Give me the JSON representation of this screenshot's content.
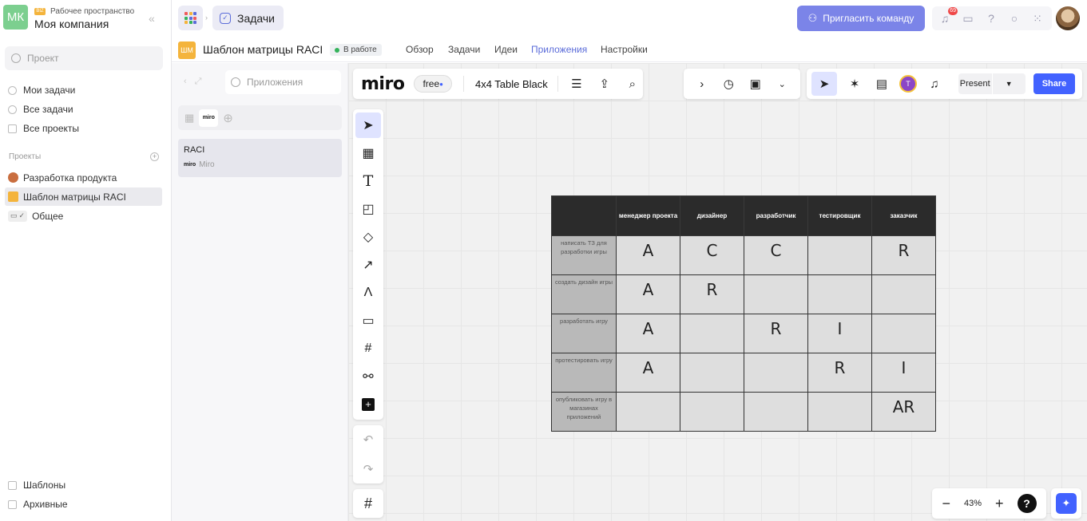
{
  "workspace": {
    "initials": "МК",
    "badge": "BIZ",
    "label": "Рабочее пространство",
    "name": "Моя компания"
  },
  "sidebar": {
    "search_placeholder": "Проект",
    "nav": [
      "Мои задачи",
      "Все задачи",
      "Все проекты"
    ],
    "projects_heading": "Проекты",
    "projects": [
      {
        "label": "Разработка продукта",
        "color": "#c96e3f"
      },
      {
        "label": "Шаблон матрицы RACI",
        "color": "#f4b43c"
      },
      {
        "label": "Общее",
        "color": "#888888"
      }
    ],
    "bottom": [
      "Шаблоны",
      "Архивные"
    ]
  },
  "topbar": {
    "section": "Задачи",
    "invite_label": "Пригласить команду",
    "notif_count": "69"
  },
  "project": {
    "icon_text": "ШМ",
    "title": "Шаблон матрицы RACI",
    "status": "В работе",
    "tabs": [
      "Обзор",
      "Задачи",
      "Идеи",
      "Приложения",
      "Настройки"
    ],
    "active_tab": "Приложения"
  },
  "apps_panel": {
    "search_placeholder": "Приложения",
    "tab_miro": "miro",
    "card": {
      "title": "RACI",
      "logo": "miro",
      "source": "Miro"
    }
  },
  "miro": {
    "logo": "miro",
    "plan": "free",
    "board_name": "4x4 Table Black",
    "collab_initial": "T",
    "present_label": "Present",
    "share_label": "Share",
    "zoom": "43%",
    "help": "?"
  },
  "raci": {
    "headers": [
      "менеджер проекта",
      "дизайнер",
      "разработчик",
      "тестировщик",
      "заказчик"
    ],
    "rows": [
      {
        "task": "написать ТЗ для разработки игры",
        "cells": [
          "A",
          "C",
          "C",
          "",
          "R"
        ]
      },
      {
        "task": "создать дизайн игры",
        "cells": [
          "A",
          "R",
          "",
          "",
          ""
        ]
      },
      {
        "task": "разработать игру",
        "cells": [
          "A",
          "",
          "R",
          "I",
          ""
        ]
      },
      {
        "task": "протестировать игру",
        "cells": [
          "A",
          "",
          "",
          "R",
          "I"
        ]
      },
      {
        "task": "опубликовать игру в магазинах приложений",
        "cells": [
          "",
          "",
          "",
          "",
          "AR"
        ]
      }
    ]
  },
  "colors": {
    "accent": "#5b6cd9",
    "miro_blue": "#4262ff",
    "invite": "#7b84e8",
    "status_green": "#34b35b"
  }
}
